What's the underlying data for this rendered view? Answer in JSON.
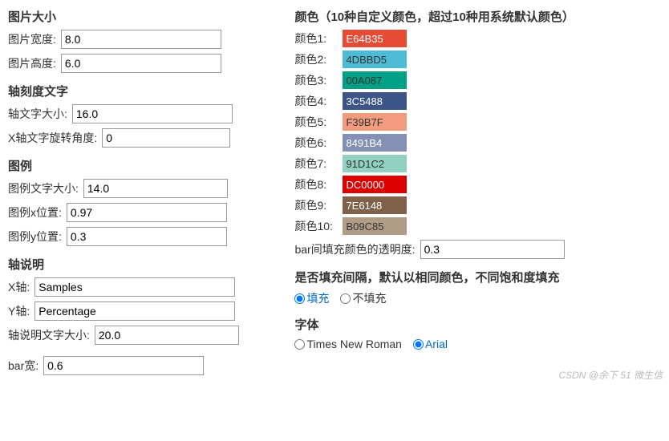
{
  "sections": {
    "image_size": {
      "title": "图片大小",
      "width_label": "图片宽度:",
      "width_value": "8.0",
      "height_label": "图片高度:",
      "height_value": "6.0"
    },
    "axis_ticks": {
      "title": "轴刻度文字",
      "font_size_label": "轴文字大小:",
      "font_size_value": "16.0",
      "x_rotation_label": "X轴文字旋转角度:",
      "x_rotation_value": "0"
    },
    "legend": {
      "title": "图例",
      "font_size_label": "图例文字大小:",
      "font_size_value": "14.0",
      "x_pos_label": "图例x位置:",
      "x_pos_value": "0.97",
      "y_pos_label": "图例y位置:",
      "y_pos_value": "0.3"
    },
    "axis_labels": {
      "title": "轴说明",
      "x_label": "X轴:",
      "x_value": "Samples",
      "y_label": "Y轴:",
      "y_value": "Percentage",
      "font_size_label": "轴说明文字大小:",
      "font_size_value": "20.0"
    },
    "bar_width": {
      "label": "bar宽:",
      "value": "0.6"
    },
    "colors": {
      "title": "颜色（10种自定义颜色，超过10种用系统默认颜色）",
      "items": [
        {
          "label": "颜色1:",
          "hex": "E64B35",
          "bg": "#E64B35",
          "fg": "#fff"
        },
        {
          "label": "颜色2:",
          "hex": "4DBBD5",
          "bg": "#4DBBD5",
          "fg": "#333"
        },
        {
          "label": "颜色3:",
          "hex": "00A087",
          "bg": "#00A087",
          "fg": "#333"
        },
        {
          "label": "颜色4:",
          "hex": "3C5488",
          "bg": "#3C5488",
          "fg": "#fff"
        },
        {
          "label": "颜色5:",
          "hex": "F39B7F",
          "bg": "#F39B7F",
          "fg": "#333"
        },
        {
          "label": "颜色6:",
          "hex": "8491B4",
          "bg": "#8491B4",
          "fg": "#fff"
        },
        {
          "label": "颜色7:",
          "hex": "91D1C2",
          "bg": "#91D1C2",
          "fg": "#333"
        },
        {
          "label": "颜色8:",
          "hex": "DC0000",
          "bg": "#DC0000",
          "fg": "#fff"
        },
        {
          "label": "颜色9:",
          "hex": "7E6148",
          "bg": "#7E6148",
          "fg": "#fff"
        },
        {
          "label": "颜色10:",
          "hex": "B09C85",
          "bg": "#B09C85",
          "fg": "#333"
        }
      ],
      "alpha_label": "bar间填充颜色的透明度:",
      "alpha_value": "0.3"
    },
    "fill": {
      "title": "是否填充间隔，默认以相同颜色，不同饱和度填充",
      "option_fill": "填充",
      "option_nofill": "不填充",
      "selected": "fill"
    },
    "font": {
      "title": "字体",
      "option_tnr": "Times New Roman",
      "option_arial": "Arial",
      "selected": "arial"
    }
  },
  "watermark": "CSDN @余下 51 微生信"
}
